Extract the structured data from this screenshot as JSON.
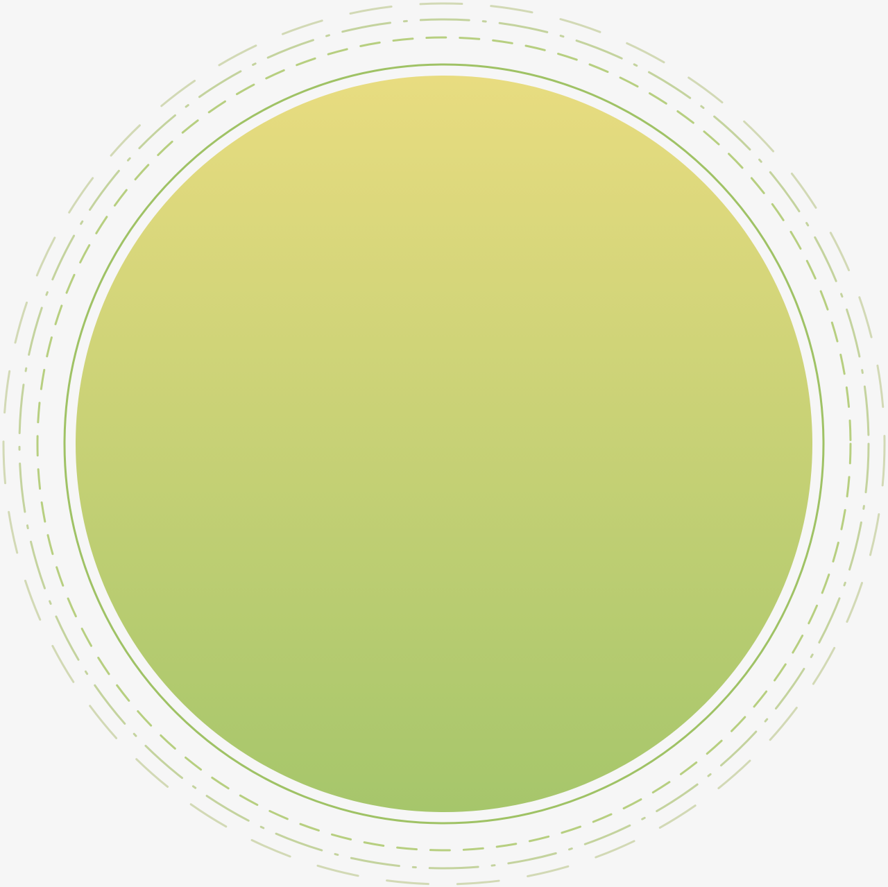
{
  "colors": {
    "background": "#f6f6f6",
    "fill_top": "#e8dc80",
    "fill_bottom": "#a6c66b",
    "inner_ring": "#9fc265",
    "dashed_ring": "#b7cf80",
    "outer_ring": "#c4d39e",
    "outermost_ring": "#d2d9b5"
  }
}
